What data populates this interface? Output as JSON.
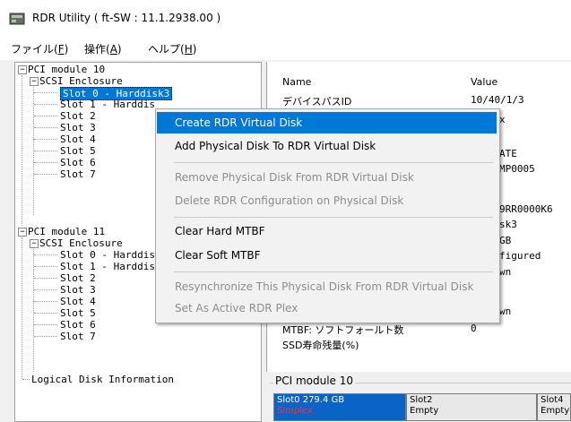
{
  "window": {
    "title": "RDR Utility ( ft-SW : 11.1.2938.00 )"
  },
  "menu": [
    {
      "label": "ファイル(",
      "key": "F",
      "tail": ")"
    },
    {
      "label": "操作(",
      "key": "A",
      "tail": ")"
    },
    {
      "label": "ヘルプ(",
      "key": "H",
      "tail": ")"
    }
  ],
  "tree": {
    "module10": "PCI module 10",
    "enc10": "SCSI Enclosure",
    "slots10": [
      "Slot 0 - Harddisk3",
      "Slot 1 - Harddis",
      "Slot 2",
      "Slot 3",
      "Slot 4",
      "Slot 5",
      "Slot 6",
      "Slot 7"
    ],
    "module11": "PCI module 11",
    "enc11": "SCSI Enclosure",
    "slots11": [
      "Slot 0 - Harddis",
      "Slot 1 - Harddis",
      "Slot 2",
      "Slot 3",
      "Slot 4",
      "Slot 5",
      "Slot 6",
      "Slot 7"
    ],
    "logical": "Logical Disk Information",
    "expander_symbol": "−"
  },
  "properties": {
    "col_name": "Name",
    "col_value": "Value",
    "rows": [
      {
        "name": "デバイスパスID",
        "value": "10/40/1/3"
      },
      {
        "name": "",
        "value": "x"
      },
      {
        "name": "",
        "value": "ATE"
      },
      {
        "name": "",
        "value": "MP0005"
      },
      {
        "name": "",
        "value": "9RR0000K6"
      },
      {
        "name": "",
        "value": "sk3"
      },
      {
        "name": "",
        "value": "GB"
      },
      {
        "name": "",
        "value": "figured"
      },
      {
        "name": "",
        "value": "wn"
      },
      {
        "name": "",
        "value": "wn"
      },
      {
        "name": "MTBF: ソフトフォールト数",
        "value": "0"
      },
      {
        "name": "SSD寿命残量(%)",
        "value": ""
      }
    ]
  },
  "group": {
    "title": "PCI module 10",
    "slots": [
      {
        "title": "Slot0  279.4 GB",
        "sub": "Simplex"
      },
      {
        "title": "Slot2",
        "sub": "Empty"
      },
      {
        "title": "Slot4",
        "sub": "Empty"
      }
    ]
  },
  "context_menu": {
    "items": [
      {
        "label": "Create RDR Virtual Disk",
        "state": "highlighted"
      },
      {
        "label": "Add Physical Disk To RDR Virtual Disk",
        "state": "enabled"
      },
      {
        "label": "Remove Physical Disk From RDR Virtual Disk",
        "state": "disabled"
      },
      {
        "label": "Delete RDR Configuration on Physical Disk",
        "state": "disabled"
      },
      {
        "label": "Clear Hard MTBF",
        "state": "enabled"
      },
      {
        "label": "Clear Soft MTBF",
        "state": "enabled"
      },
      {
        "label": "Resynchronize This Physical Disk From RDR Virtual Disk",
        "state": "disabled"
      },
      {
        "label": "Set As Active RDR Plex",
        "state": "disabled"
      }
    ]
  },
  "colors": {
    "selection": "#0078d7",
    "slot_active": "#0a64c8",
    "simplex_text": "#e23a3a"
  },
  "icons": {
    "app": "disk-drive-icon"
  }
}
